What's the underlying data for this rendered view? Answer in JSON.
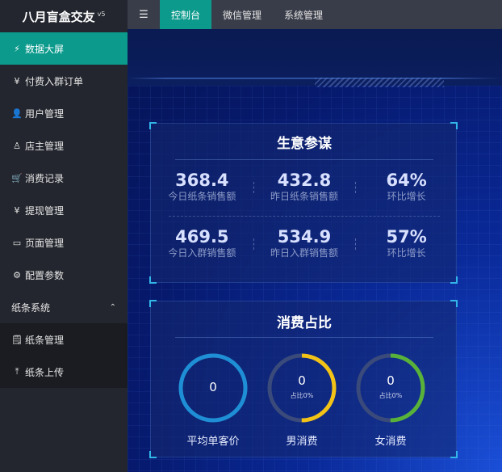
{
  "brand": {
    "name": "八月盲盒交友",
    "version": "v5"
  },
  "sidebar": {
    "items": [
      {
        "label": "数据大屏",
        "icon": "lightning-icon",
        "glyph": "⚡",
        "active": true
      },
      {
        "label": "付费入群订单",
        "icon": "yen-circle-icon",
        "glyph": "¥",
        "active": false
      },
      {
        "label": "用户管理",
        "icon": "user-icon",
        "glyph": "👤",
        "active": false
      },
      {
        "label": "店主管理",
        "icon": "users-icon",
        "glyph": "♙",
        "active": false
      },
      {
        "label": "消费记录",
        "icon": "cart-icon",
        "glyph": "🛒",
        "active": false
      },
      {
        "label": "提现管理",
        "icon": "yen-icon",
        "glyph": "¥",
        "active": false
      },
      {
        "label": "页面管理",
        "icon": "window-icon",
        "glyph": "▭",
        "active": false
      },
      {
        "label": "配置参数",
        "icon": "gear-icon",
        "glyph": "⚙",
        "active": false
      }
    ],
    "group": {
      "label": "纸条系统",
      "icon": "chevron-up-icon",
      "glyph": "⌃"
    },
    "sub_items": [
      {
        "label": "纸条管理",
        "icon": "note-icon",
        "glyph": "🗒"
      },
      {
        "label": "纸条上传",
        "icon": "upload-icon",
        "glyph": "⤒"
      }
    ]
  },
  "topbar": {
    "toggle_glyph": "☰",
    "tabs": [
      {
        "label": "控制台",
        "active": true
      },
      {
        "label": "微信管理",
        "active": false
      },
      {
        "label": "系统管理",
        "active": false
      }
    ]
  },
  "business": {
    "title": "生意参谋",
    "rows": [
      [
        {
          "value": "368.4",
          "label": "今日纸条销售额"
        },
        {
          "value": "432.8",
          "label": "昨日纸条销售额"
        },
        {
          "value": "64%",
          "label": "环比增长"
        }
      ],
      [
        {
          "value": "469.5",
          "label": "今日入群销售额"
        },
        {
          "value": "534.9",
          "label": "昨日入群销售额"
        },
        {
          "value": "57%",
          "label": "环比增长"
        }
      ]
    ]
  },
  "consumption": {
    "title": "消费占比",
    "gauges": [
      {
        "value": "0",
        "sub": "",
        "label": "平均单客价",
        "color": "#1e8fd6",
        "fraction": 1.0
      },
      {
        "value": "0",
        "sub": "占比0%",
        "label": "男消费",
        "color": "#f2c316",
        "fraction": 0.5
      },
      {
        "value": "0",
        "sub": "占比0%",
        "label": "女消费",
        "color": "#58b23a",
        "fraction": 0.5
      }
    ],
    "track_color": "#3a4a7a"
  }
}
